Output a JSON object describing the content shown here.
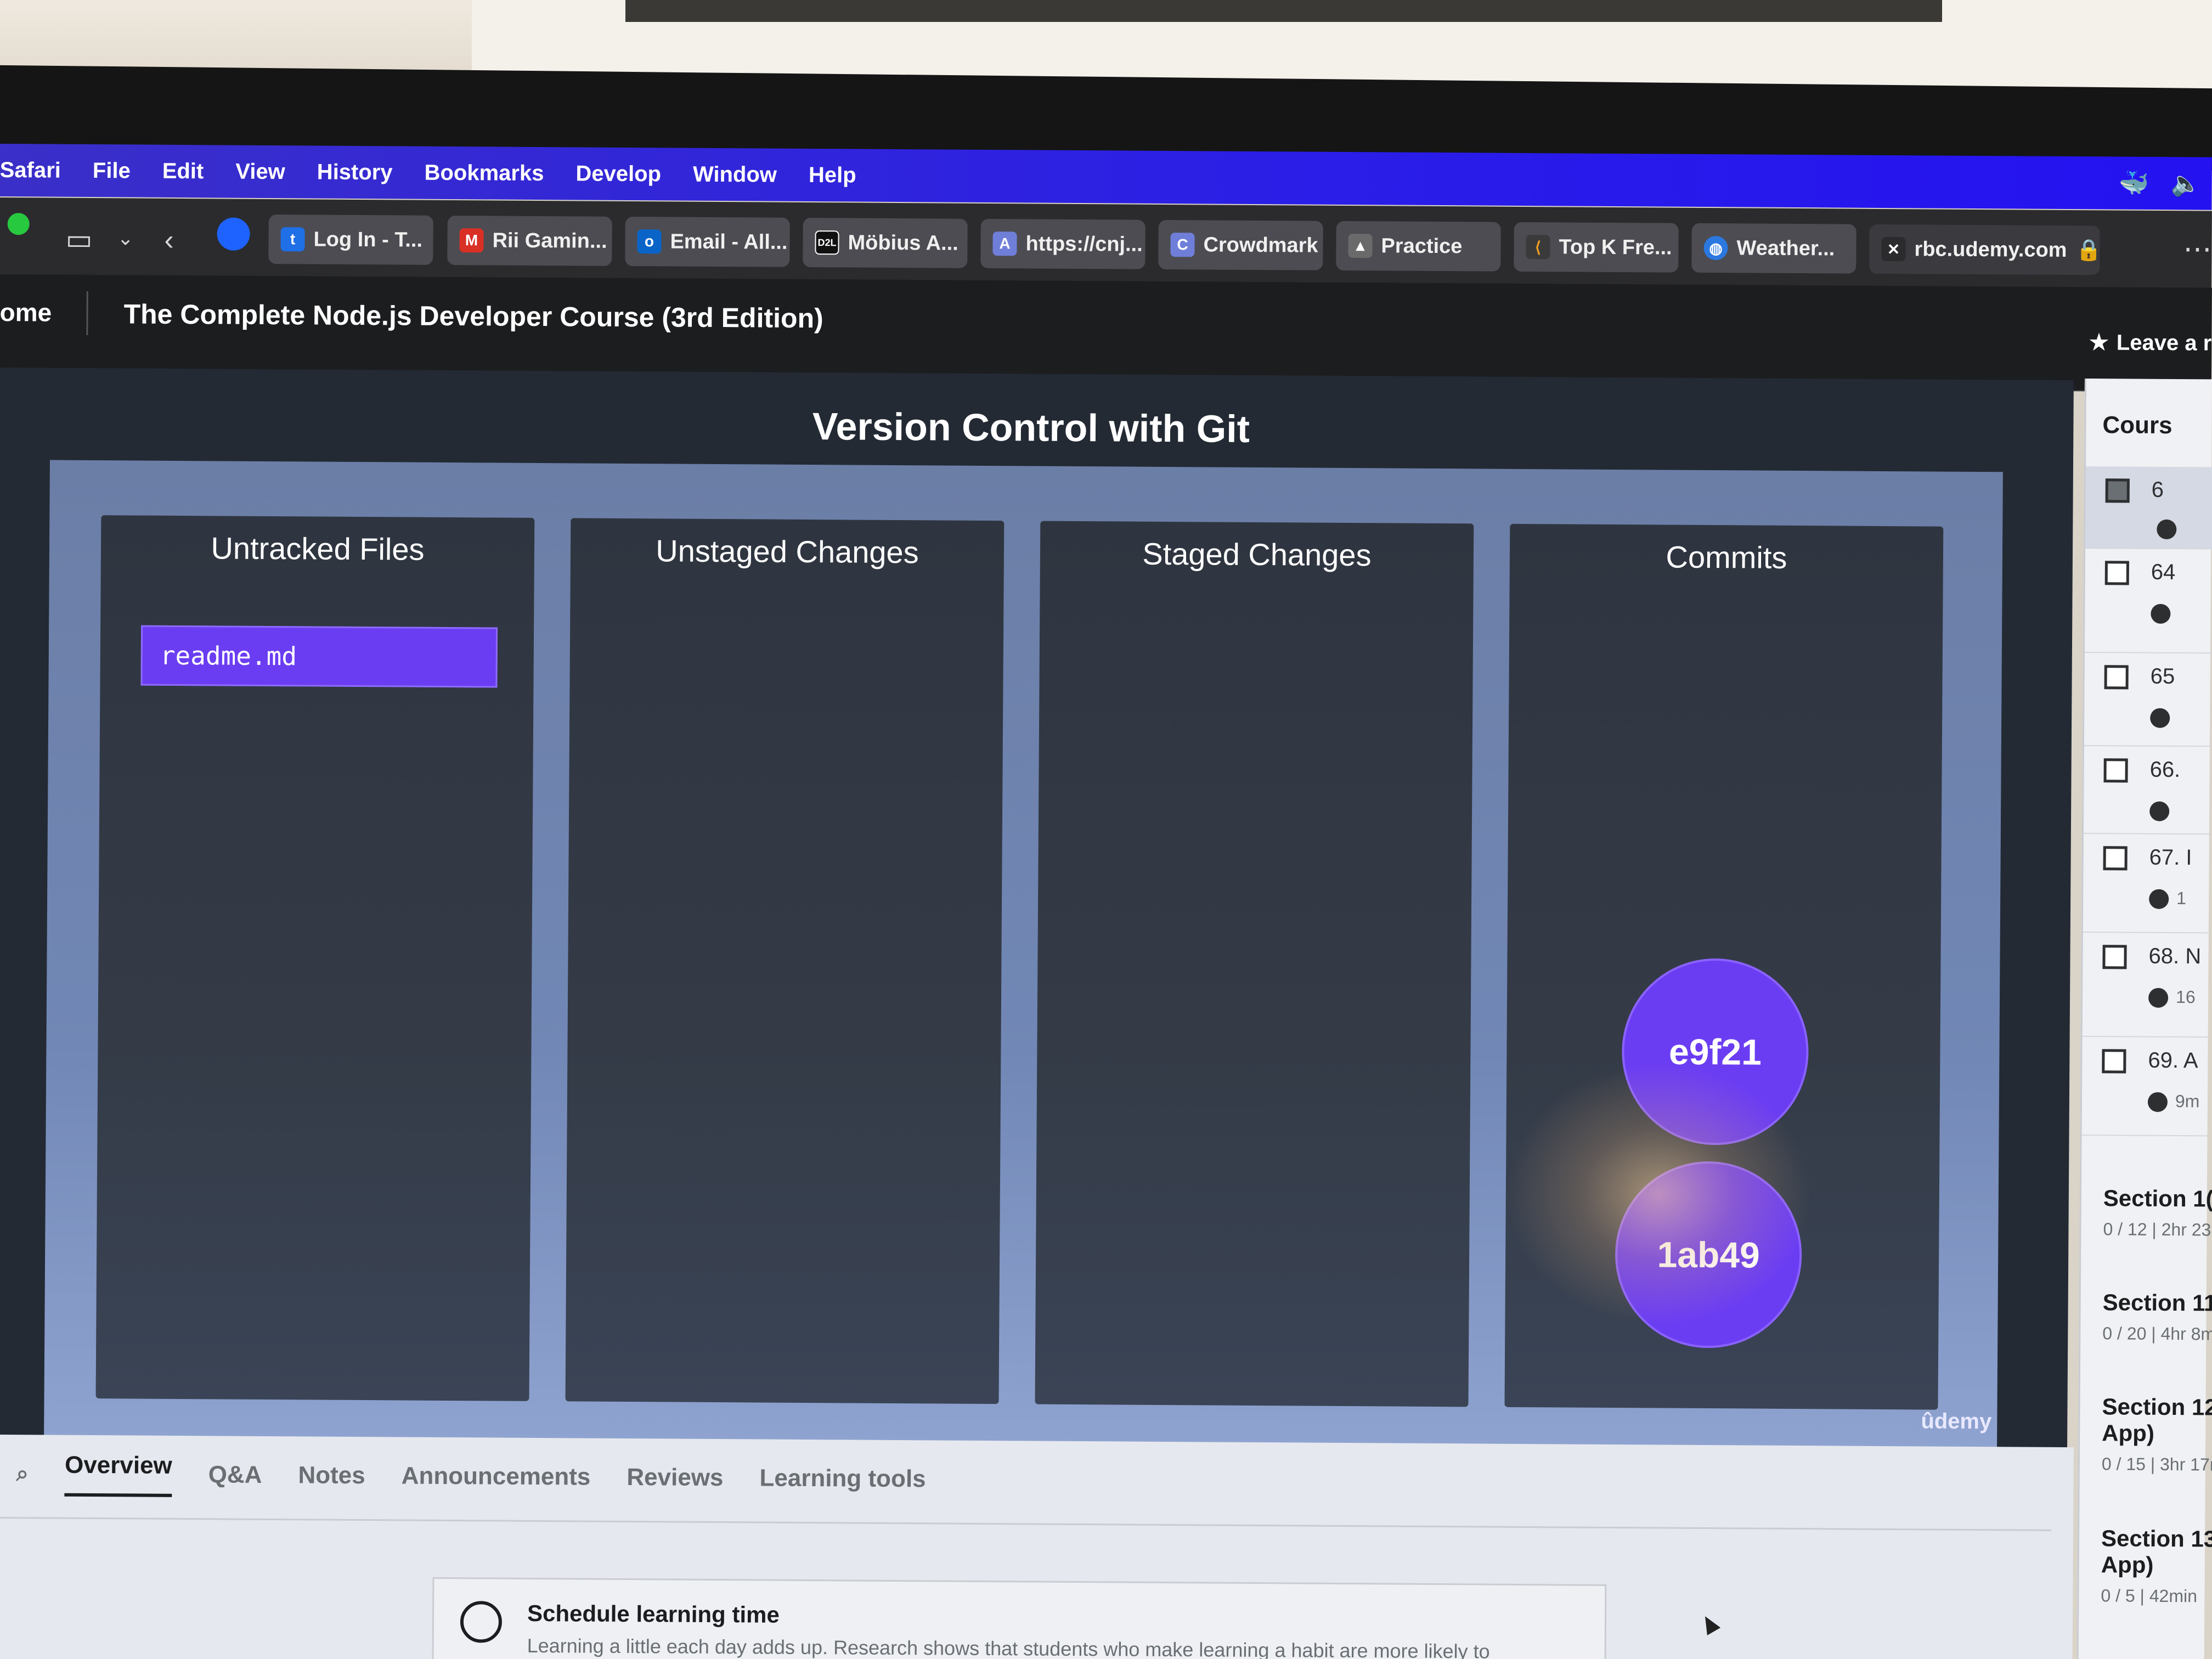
{
  "menubar": {
    "items": [
      "Safari",
      "File",
      "Edit",
      "View",
      "History",
      "Bookmarks",
      "Develop",
      "Window",
      "Help"
    ]
  },
  "tabs": [
    {
      "label": "Log In - T...",
      "icon": "trello-icon",
      "color": "#1f6fe6"
    },
    {
      "label": "Rii Gamin...",
      "icon": "gmail-icon",
      "color": "#d93025"
    },
    {
      "label": "Email - All...",
      "icon": "outlook-icon",
      "color": "#0a64c8"
    },
    {
      "label": "Möbius A...",
      "icon": "d2l-icon",
      "color": "#111111"
    },
    {
      "label": "https://cnj...",
      "icon": "letter-a-icon",
      "color": "#6f7fd9"
    },
    {
      "label": "Crowdmark",
      "icon": "crowdmark-icon",
      "color": "#6f7fd9"
    },
    {
      "label": "Practice",
      "icon": "rocket-icon",
      "color": "#6a6a6a"
    },
    {
      "label": "Top K Fre...",
      "icon": "leetcode-icon",
      "color": "#f0a020"
    },
    {
      "label": "Weather...",
      "icon": "globe-icon",
      "color": "#2a78e0"
    },
    {
      "label": "rbc.udemy.com",
      "icon": "udemy-icon",
      "color": "#2b2b2e"
    }
  ],
  "course": {
    "home_label": "ome",
    "title": "The Complete Node.js Developer Course (3rd Edition)",
    "leave_rating": "Leave a r"
  },
  "slide": {
    "title": "Version Control with Git",
    "columns": [
      "Untracked Files",
      "Unstaged Changes",
      "Staged Changes",
      "Commits"
    ],
    "untracked_file": "readme.md",
    "commits": [
      "e9f21",
      "1ab49"
    ],
    "brand": "ûdemy"
  },
  "lower_tabs": {
    "items": [
      "Overview",
      "Q&A",
      "Notes",
      "Announcements",
      "Reviews",
      "Learning tools"
    ],
    "active": "Overview"
  },
  "schedule": {
    "title": "Schedule learning time",
    "desc": "Learning a little each day adds up. Research shows that students who make learning a habit are more likely to"
  },
  "sidebar": {
    "header": "Cours",
    "items": [
      "6",
      "64",
      "65",
      "66.",
      "67. I",
      "68. N",
      "69. A"
    ],
    "sub": [
      "",
      "",
      "",
      "",
      "1",
      "16",
      "9m"
    ],
    "sections": [
      {
        "title": "Section 1(",
        "meta": "0 / 12 | 2hr 23"
      },
      {
        "title": "Section 11",
        "meta": "0 / 20 | 4hr 8m"
      },
      {
        "title": "Section 12",
        "title2": "App)",
        "meta": "0 / 15 | 3hr 17mi"
      },
      {
        "title": "Section 13:",
        "title2": "App)",
        "meta": "0 / 5 | 42min"
      }
    ]
  }
}
